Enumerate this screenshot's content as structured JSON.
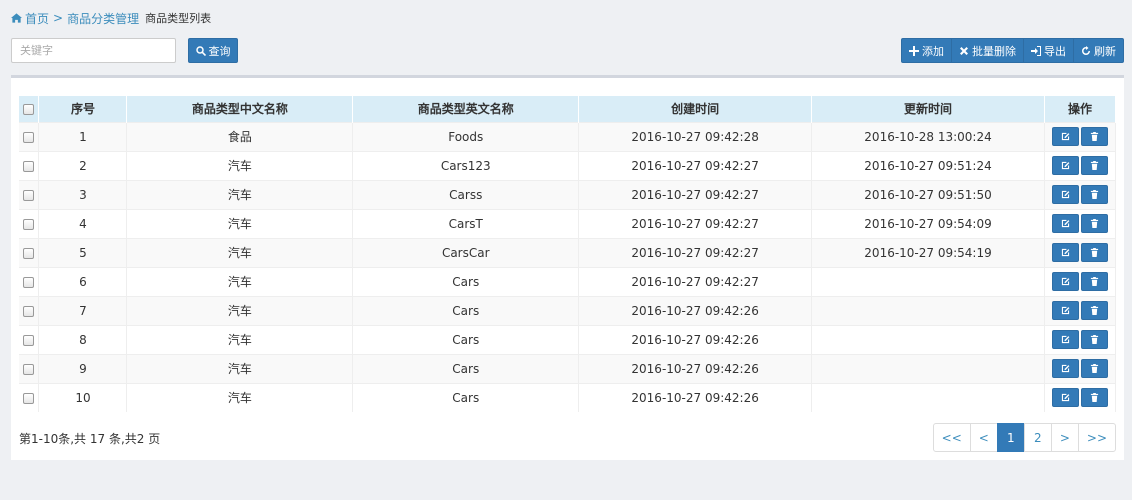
{
  "breadcrumb": {
    "home": "首页",
    "separator": ">",
    "section": "商品分类管理",
    "current": "商品类型列表"
  },
  "search": {
    "placeholder": "关键字",
    "value": "",
    "button_label": "查询"
  },
  "toolbar": {
    "add_label": "添加",
    "batch_delete_label": "批量删除",
    "export_label": "导出",
    "refresh_label": "刷新"
  },
  "table": {
    "columns": [
      "序号",
      "商品类型中文名称",
      "商品类型英文名称",
      "创建时间",
      "更新时间",
      "操作"
    ],
    "rows": [
      {
        "id": "1",
        "cn": "食品",
        "en": "Foods",
        "created": "2016-10-27 09:42:28",
        "updated": "2016-10-28 13:00:24"
      },
      {
        "id": "2",
        "cn": "汽车",
        "en": "Cars123",
        "created": "2016-10-27 09:42:27",
        "updated": "2016-10-27 09:51:24"
      },
      {
        "id": "3",
        "cn": "汽车",
        "en": "Carss",
        "created": "2016-10-27 09:42:27",
        "updated": "2016-10-27 09:51:50"
      },
      {
        "id": "4",
        "cn": "汽车",
        "en": "CarsT",
        "created": "2016-10-27 09:42:27",
        "updated": "2016-10-27 09:54:09"
      },
      {
        "id": "5",
        "cn": "汽车",
        "en": "CarsCar",
        "created": "2016-10-27 09:42:27",
        "updated": "2016-10-27 09:54:19"
      },
      {
        "id": "6",
        "cn": "汽车",
        "en": "Cars",
        "created": "2016-10-27 09:42:27",
        "updated": ""
      },
      {
        "id": "7",
        "cn": "汽车",
        "en": "Cars",
        "created": "2016-10-27 09:42:26",
        "updated": ""
      },
      {
        "id": "8",
        "cn": "汽车",
        "en": "Cars",
        "created": "2016-10-27 09:42:26",
        "updated": ""
      },
      {
        "id": "9",
        "cn": "汽车",
        "en": "Cars",
        "created": "2016-10-27 09:42:26",
        "updated": ""
      },
      {
        "id": "10",
        "cn": "汽车",
        "en": "Cars",
        "created": "2016-10-27 09:42:26",
        "updated": ""
      }
    ]
  },
  "pagination": {
    "info": "第1-10条,共 17 条,共2 页",
    "first": "<<",
    "prev": "<",
    "pages": [
      "1",
      "2"
    ],
    "active_page": "1",
    "next": ">",
    "last": ">>"
  },
  "icons": {
    "home": "home-icon",
    "search": "search-icon",
    "add": "plus-icon",
    "batch_delete": "times-icon",
    "export": "sign-in-icon",
    "refresh": "refresh-icon",
    "edit": "edit-icon",
    "delete": "trash-icon"
  },
  "colors": {
    "primary": "#337ab7",
    "link": "#3c8dbc",
    "header_bg": "#d9edf7",
    "page_bg": "#eef0f3"
  }
}
